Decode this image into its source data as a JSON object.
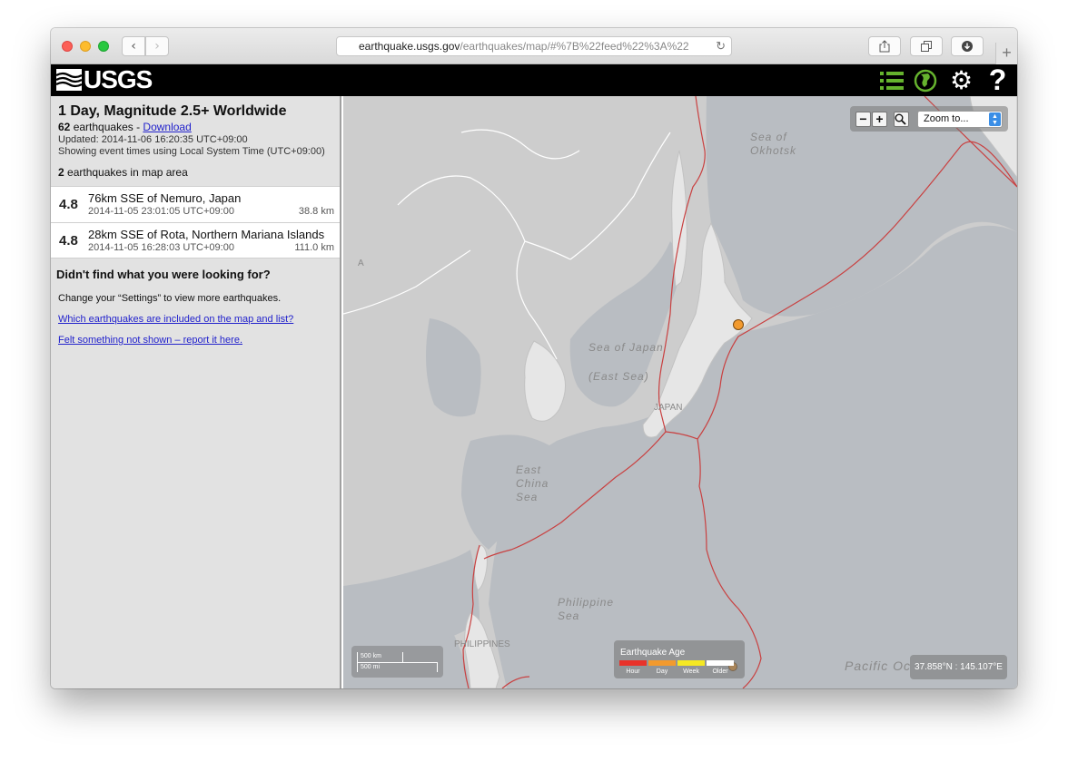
{
  "browser": {
    "url_host": "earthquake.usgs.gov",
    "url_path": "/earthquakes/map/#%7B%22feed%22%3A%22",
    "back_icon": "chevron-left-icon",
    "forward_icon": "chevron-right-icon"
  },
  "header": {
    "logo_text": "USGS"
  },
  "sidebar": {
    "title": "1 Day, Magnitude 2.5+ Worldwide",
    "count": "62",
    "count_suffix": " earthquakes - ",
    "download_label": "Download",
    "updated": "Updated: 2014-11-06 16:20:35 UTC+09:00",
    "timezone_note": "Showing event times using Local System Time (UTC+09:00)",
    "in_area_count": "2",
    "in_area_suffix": " earthquakes in map area",
    "earthquakes": [
      {
        "mag": "4.8",
        "place": "76km SSE of Nemuro, Japan",
        "time": "2014-11-05 23:01:05 UTC+09:00",
        "depth": "38.8 km"
      },
      {
        "mag": "4.8",
        "place": "28km SSE of Rota, Northern Mariana Islands",
        "time": "2014-11-05 16:28:03 UTC+09:00",
        "depth": "111.0 km"
      }
    ],
    "help_title": "Didn't find what you were looking for?",
    "help_text": "Change your “Settings” to view more earthquakes.",
    "help_link1": "Which earthquakes are included on the map and list?",
    "help_link2": "Felt something not shown – report it here."
  },
  "map": {
    "labels": {
      "okhotsk_1": "Sea of",
      "okhotsk_2": "Okhotsk",
      "japan_sea_1": "Sea of Japan",
      "japan_sea_2": "(East Sea)",
      "japan": "JAPAN",
      "ecs_1": "East",
      "ecs_2": "China",
      "ecs_3": "Sea",
      "phil_sea_1": "Philippine",
      "phil_sea_2": "Sea",
      "philippines": "PHILIPPINES",
      "pacific": "Pacific Oc",
      "a_letter": "A"
    },
    "zoom": {
      "minus": "−",
      "plus": "+",
      "select_value": "Zoom to..."
    },
    "scale": {
      "km": "500 km",
      "mi": "500 mi"
    },
    "age_legend": {
      "title": "Earthquake Age",
      "items": [
        {
          "label": "Hour",
          "color": "#e8322a"
        },
        {
          "label": "Day",
          "color": "#f29a2e"
        },
        {
          "label": "Week",
          "color": "#f5e823"
        },
        {
          "label": "Older",
          "color": "#ffffff"
        }
      ]
    },
    "coordinates": "37.858°N : 145.107°E"
  }
}
